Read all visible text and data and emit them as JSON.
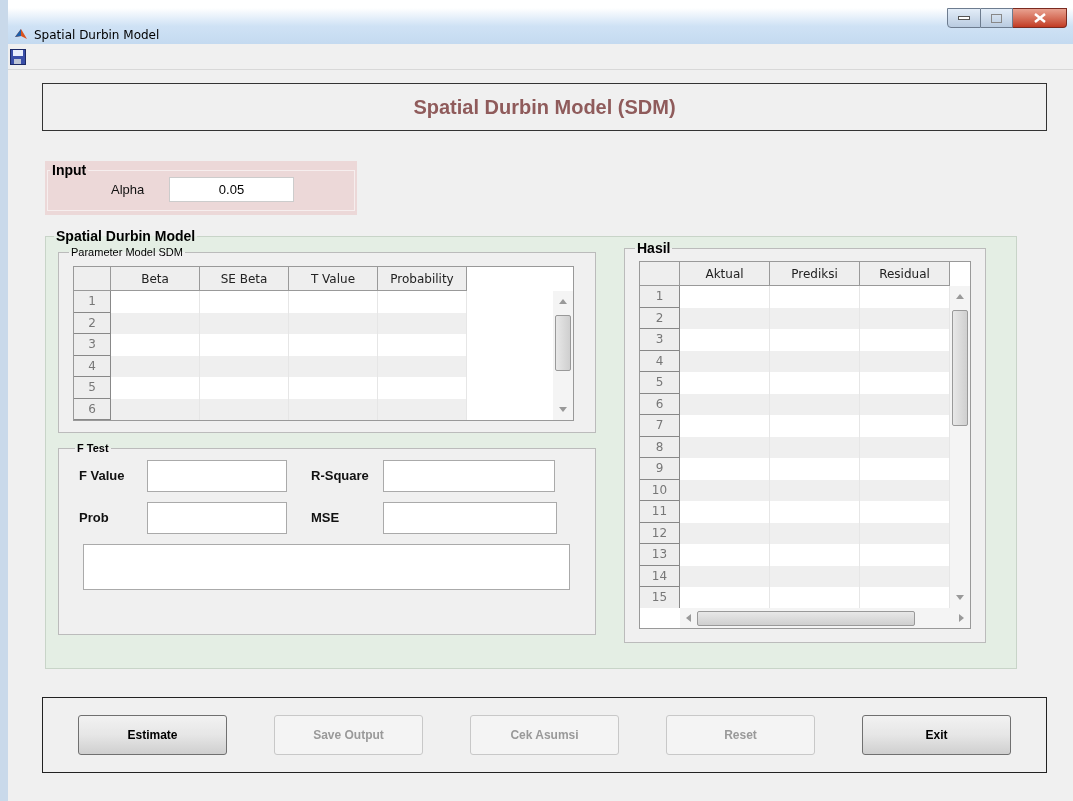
{
  "window": {
    "title": "Spatial Durbin Model"
  },
  "header": {
    "title": "Spatial Durbin Model (SDM)"
  },
  "input_panel": {
    "title": "Input",
    "alpha_label": "Alpha",
    "alpha_value": "0.05"
  },
  "sdm_panel": {
    "title": "Spatial Durbin Model",
    "parameter_table": {
      "title": "Parameter Model SDM",
      "columns": [
        "Beta",
        "SE Beta",
        "T Value",
        "Probability"
      ],
      "row_numbers": [
        "1",
        "2",
        "3",
        "4",
        "5",
        "6"
      ]
    },
    "f_test": {
      "title": "F Test",
      "fields": [
        {
          "label": "F Value"
        },
        {
          "label": "R-Square"
        },
        {
          "label": "Prob"
        },
        {
          "label": "MSE"
        }
      ]
    },
    "hasil": {
      "title": "Hasil",
      "columns": [
        "Aktual",
        "Prediksi",
        "Residual"
      ],
      "row_numbers": [
        "1",
        "2",
        "3",
        "4",
        "5",
        "6",
        "7",
        "8",
        "9",
        "10",
        "11",
        "12",
        "13",
        "14",
        "15"
      ]
    }
  },
  "buttons": [
    {
      "label": "Estimate",
      "disabled": false
    },
    {
      "label": "Save Output",
      "disabled": true
    },
    {
      "label": "Cek Asumsi",
      "disabled": true
    },
    {
      "label": "Reset",
      "disabled": true
    },
    {
      "label": "Exit",
      "disabled": false
    }
  ]
}
